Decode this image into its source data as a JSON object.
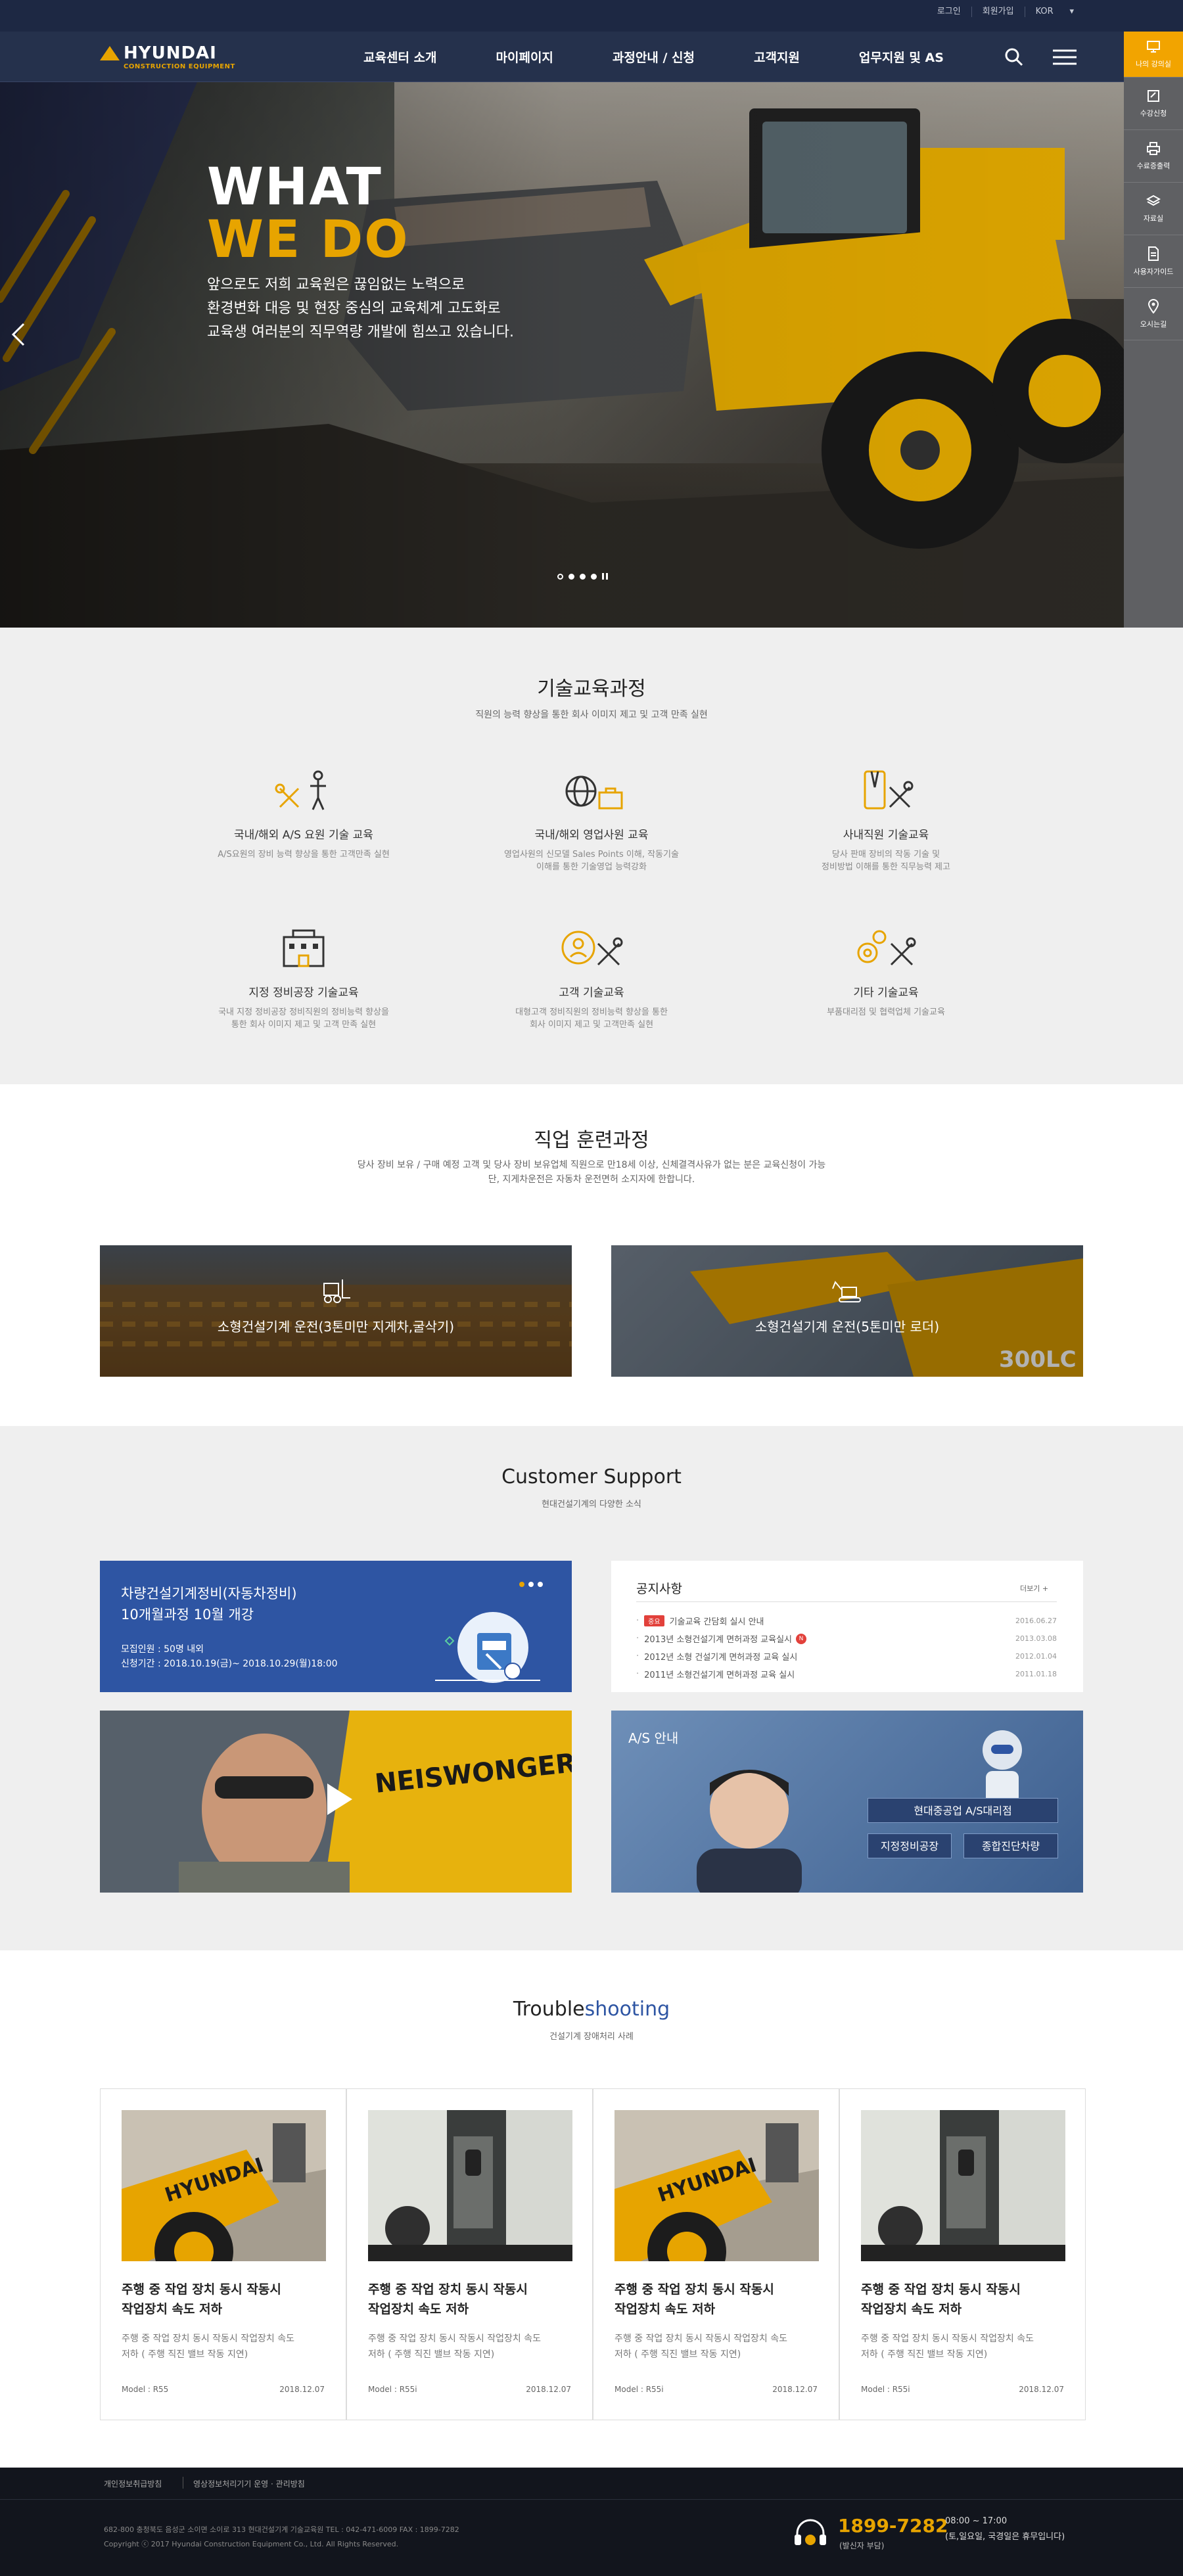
{
  "util": {
    "login": "로그인",
    "join": "회원가입",
    "lang": "KOR"
  },
  "logo": {
    "brand": "HYUNDAI",
    "sub": "CONSTRUCTION EQUIPMENT"
  },
  "nav": [
    "교육센터 소개",
    "마이페이지",
    "과정안내 / 신청",
    "고객지원",
    "업무지원 및 AS"
  ],
  "quick": [
    "나의 강의실",
    "수강신청",
    "수료증출력",
    "자료실",
    "사용자가이드",
    "오시는길"
  ],
  "hero": {
    "title1": "WHAT",
    "title2": "WE DO",
    "lines": [
      "앞으로도 저희 교육원은 끊임없는 노력으로",
      "환경변화 대응 및 현장 중심의 교육체계 고도화로",
      "교육생 여러분의 직무역량 개발에 힘쓰고 있습니다."
    ]
  },
  "tech": {
    "title": "기술교육과정",
    "sub": "직원의 능력 향상을 통한 회사 이미지 제고 및 고객 만족 실현",
    "courses": [
      {
        "title": "국내/해외 A/S 요원 기술 교육",
        "desc1": "A/S요원의 장비 능력 향상을 통한 고객만족 실현",
        "desc2": ""
      },
      {
        "title": "국내/해외 영업사원 교육",
        "desc1": "영업사원의 신모델 Sales Points 이해, 작동기술",
        "desc2": "이해를 통한 기술영업 능력강화"
      },
      {
        "title": "사내직원 기술교육",
        "desc1": "당사 판매 장비의 작동 기술 및",
        "desc2": "정비방법 이해를 통한 직무능력 제고"
      },
      {
        "title": "지정 정비공장 기술교육",
        "desc1": "국내 지정 정비공장 정비직원의 정비능력 향상을",
        "desc2": "통한 회사 이미지 제고 및 고객 만족 실현"
      },
      {
        "title": "고객 기술교육",
        "desc1": "대형고객 정비직원의 정비능력 향상을 통한",
        "desc2": "회사 이미지 제고 및 고객만족 실현"
      },
      {
        "title": "기타 기술교육",
        "desc1": "부품대리점 및 협력업체 기술교육",
        "desc2": ""
      }
    ]
  },
  "job": {
    "title": "직업 훈련과정",
    "sub1": "당사 장비 보유 / 구매 예정 고객 및 당사 장비 보유업체 직원으로 만18세 이상, 신체결격사유가 없는 분은 교육신청이 가능",
    "sub2": "단, 지게차운전은 자동차 운전면허 소지자에 한합니다.",
    "cards": [
      "소형건설기계 운전(3톤미만 지게차,굴삭기)",
      "소형건설기계 운전(5톤미만 로더)"
    ]
  },
  "cs": {
    "title": "Customer Support",
    "sub": "현대건설기계의 다양한 소식",
    "banner": {
      "line1": "차량건설기계정비(자동차정비)",
      "line2": "10개월과정 10월 개강",
      "info1": "모집인원 : 50명 내외",
      "info2": "신청기간 : 2018.10.19(금)~ 2018.10.29(월)18:00"
    },
    "notice": {
      "title": "공지사항",
      "more": "더보기 +",
      "items": [
        {
          "badge": "중요",
          "text": "기술교육 간담회 실시 안내",
          "date": "2016.06.27",
          "new": false
        },
        {
          "badge": "",
          "text": "2013년 소형건설기계 면허과정 교육실시",
          "date": "2013.03.08",
          "new": true
        },
        {
          "badge": "",
          "text": "2012년 소형 건설기계 면허과정 교육 실시",
          "date": "2012.01.04",
          "new": false
        },
        {
          "badge": "",
          "text": "2011년 소형건설기계 면허과정 교육 실시",
          "date": "2011.01.18",
          "new": false
        }
      ]
    },
    "as": {
      "label": "A/S 안내",
      "btn1": "현대중공업 A/S대리점",
      "btn2": "지정정비공장",
      "btn3": "종합진단차량"
    },
    "video_sign": "NEISWONGER Construction"
  },
  "trouble": {
    "title1": "Trouble",
    "title2": "shooting",
    "sub": "건설기계 장애처리 사례",
    "cards": [
      {
        "t1": "주행 중 작업 장치 동시 작동시",
        "t2": "작업장치 속도 저하",
        "d1": "주행 중 작업 장치 동시 작동시 작업장치 속도",
        "d2": "저하 ( 주행 직진 밸브 작동 지연)",
        "model": "Model : R55",
        "date": "2018.12.07",
        "img": "loader"
      },
      {
        "t1": "주행 중 작업 장치 동시 작동시",
        "t2": "작업장치 속도 저하",
        "d1": "주행 중 작업 장치 동시 작동시 작업장치 속도",
        "d2": "저하 ( 주행 직진 밸브 작동 지연)",
        "model": "Model : R55i",
        "date": "2018.12.07",
        "img": "cabin"
      },
      {
        "t1": "주행 중 작업 장치 동시 작동시",
        "t2": "작업장치 속도 저하",
        "d1": "주행 중 작업 장치 동시 작동시 작업장치 속도",
        "d2": "저하 ( 주행 직진 밸브 작동 지연)",
        "model": "Model : R55i",
        "date": "2018.12.07",
        "img": "loader"
      },
      {
        "t1": "주행 중 작업 장치 동시 작동시",
        "t2": "작업장치 속도 저하",
        "d1": "주행 중 작업 장치 동시 작동시 작업장치 속도",
        "d2": "저하 ( 주행 직진 밸브 작동 지연)",
        "model": "Model : R55i",
        "date": "2018.12.07",
        "img": "cabin"
      }
    ]
  },
  "footer": {
    "links": [
      "개인정보취급방침",
      "영상정보처리기기 운영 · 관리방침"
    ],
    "addr": "682-800  충청북도 음성군 소이면 소이로 313 현대건설기계 기술교육원 TEL : 042-471-6009 FAX : 1899-7282",
    "copy": "Copyright ⓒ 2017 Hyundai Construction Equipment Co., Ltd. All Rights Reserved.",
    "phone": "1899-7282",
    "phone_sub": "(발신자 부담)",
    "hours1": "08:00 ~ 17:00",
    "hours2": "(토,일요일, 국경일은 휴무입니다)"
  },
  "colors": {
    "accent": "#e7a400",
    "navy": "#1d2843",
    "blue": "#2e55a3",
    "badge": "#e2413b"
  }
}
